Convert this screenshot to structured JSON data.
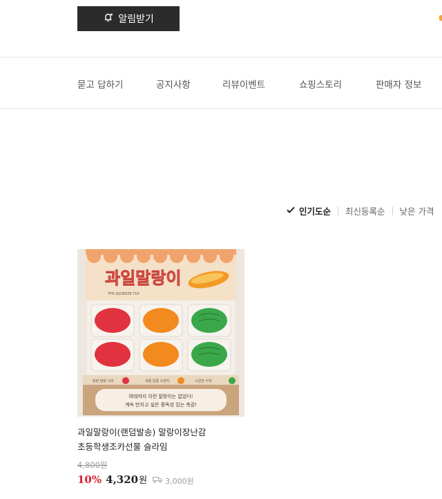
{
  "header": {
    "alarm_button": "알림받기",
    "alarm_icon": "bell-plus-icon"
  },
  "nav": {
    "items": [
      {
        "label": "묻고 답하기"
      },
      {
        "label": "공지사항"
      },
      {
        "label": "리뷰이벤트"
      },
      {
        "label": "쇼핑스토리"
      },
      {
        "label": "판매자 정보"
      }
    ]
  },
  "sort": {
    "items": [
      {
        "label": "인기도순",
        "active": true,
        "icon": "checkmark-icon"
      },
      {
        "label": "최신등록순",
        "active": false
      },
      {
        "label": "낮은 가격",
        "active": false
      }
    ]
  },
  "products": [
    {
      "name_line1": "과일말랑이(랜덤발송) 말랑이장난감",
      "name_line2": "초등학생조카선물 슬라임",
      "original_price": "4,800원",
      "discount": "10%",
      "price": "4,320",
      "currency": "원",
      "shipping_icon": "truck-icon",
      "shipping_fee": "3,000원",
      "image": {
        "banner_text": "과일말랑이",
        "box_small_text": "TPR SQUEEZE TOY",
        "bottom_text_line1": "여태까지 이런 말랑이는 없었다!",
        "bottom_text_line2": "계속 만지고 싶은 중독성 있는 촉감!",
        "label_left": "말랑 말랑 사과",
        "label_mid": "새콤 달콤 오렌지",
        "label_right": "시원한 수박",
        "colors": {
          "apple": "#e0333f",
          "orange": "#f28a1e",
          "melon": "#3aa84a",
          "banner": "#f5e0c8"
        }
      }
    }
  ]
}
